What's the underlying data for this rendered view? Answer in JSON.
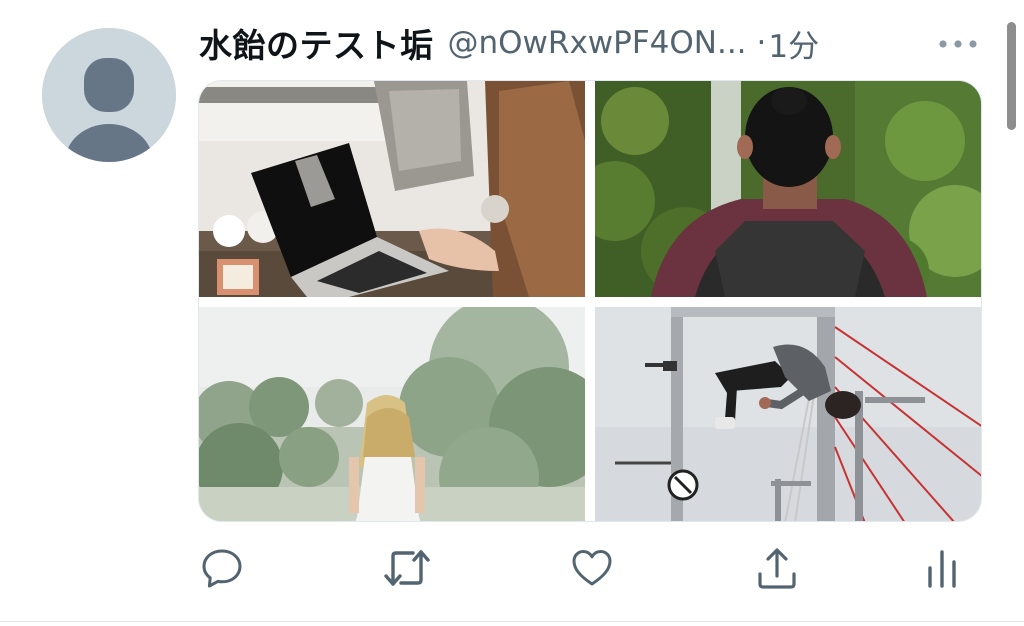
{
  "tweet": {
    "display_name": "水飴のテスト垢",
    "handle": "@nOwRxwPF4ON...",
    "separator": "·",
    "time": "1分"
  },
  "icons": {
    "avatar": "default-avatar-icon",
    "more": "more-dots-icon",
    "reply": "reply-icon",
    "retweet": "retweet-icon",
    "like": "heart-icon",
    "share": "share-icon",
    "analytics": "analytics-icon"
  },
  "colors": {
    "text_primary": "#0f1419",
    "text_secondary": "#536471",
    "icon": "#536471",
    "avatar_bg": "#ccd6dd",
    "avatar_fg": "#657786"
  }
}
